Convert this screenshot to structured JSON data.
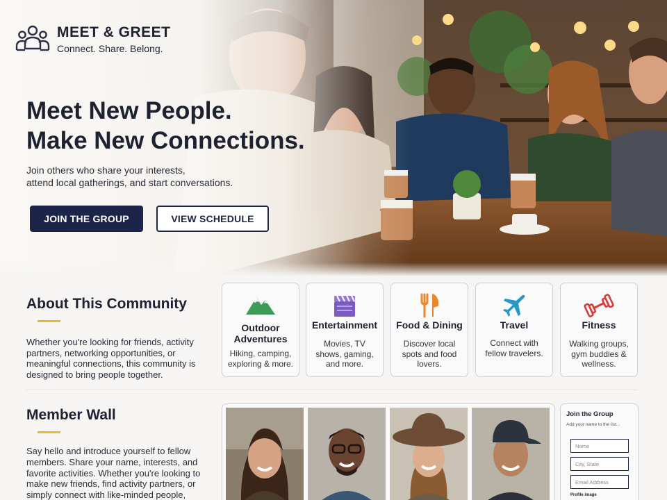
{
  "brand": {
    "title": "MEET & GREET",
    "tagline": "Connect. Share. Belong."
  },
  "hero": {
    "headline_line1": "Meet New People.",
    "headline_line2": "Make New Connections.",
    "subtext_line1": "Join others who share your interests,",
    "subtext_line2": "attend local gatherings, and start conversations.",
    "primary_button": "JOIN THE GROUP",
    "secondary_button": "VIEW SCHEDULE"
  },
  "about": {
    "title": "About This Community",
    "text": "Whether you're looking for friends, activity partners, networking opportunities, or meaningful connections, this community is designed to bring people together.",
    "categories": [
      {
        "icon": "mountain-icon",
        "title": "Outdoor Adventures",
        "desc": "Hiking, camping, exploring & more.",
        "color": "#3f9b5a"
      },
      {
        "icon": "clapperboard-icon",
        "title": "Entertainment",
        "desc": "Movies, TV shows, gaming, and more.",
        "color": "#7c5cc4"
      },
      {
        "icon": "fork-knife-icon",
        "title": "Food & Dining",
        "desc": "Discover local spots and food lovers.",
        "color": "#e9872a"
      },
      {
        "icon": "airplane-icon",
        "title": "Travel",
        "desc": "Connect with fellow travelers.",
        "color": "#2a97c7"
      },
      {
        "icon": "dumbbell-icon",
        "title": "Fitness",
        "desc": "Walking groups, gym buddies & wellness.",
        "color": "#d93a3a"
      }
    ]
  },
  "wall": {
    "title": "Member Wall",
    "text": "Say hello and introduce yourself to fellow members. Share your name, interests, and favorite activities. Whether you're looking to make new friends, find activity partners, or simply connect with like-minded people,"
  },
  "join_form": {
    "title": "Join the Group",
    "subtitle": "Add your name to the list...",
    "name_placeholder": "Name",
    "location_placeholder": "City, State",
    "email_placeholder": "Email Address",
    "image_label": "Profile image"
  },
  "colors": {
    "navy": "#1c2547",
    "accent": "#e8b931"
  }
}
